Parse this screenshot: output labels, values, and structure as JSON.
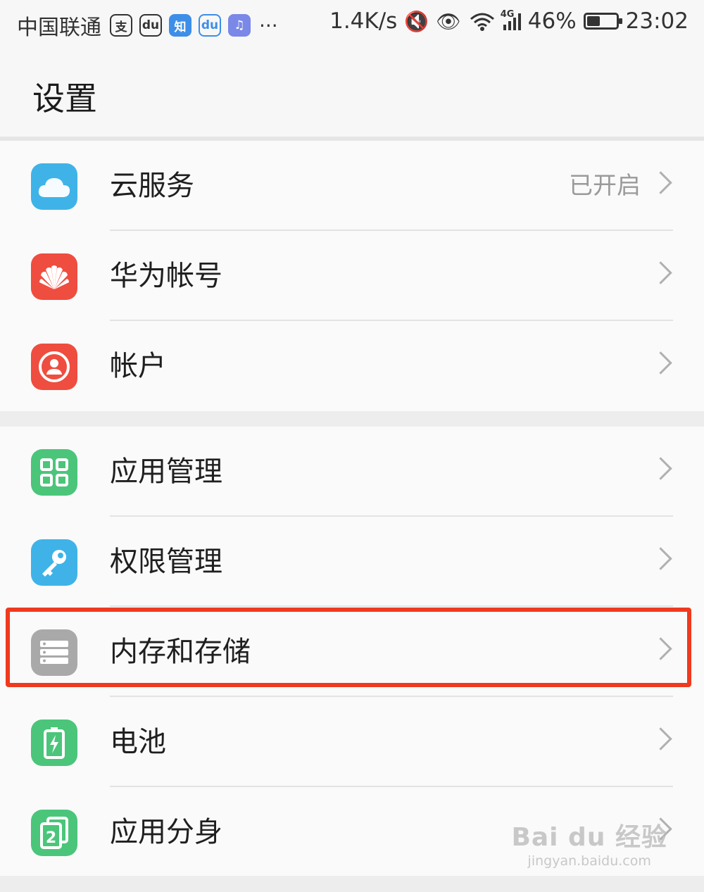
{
  "status_bar": {
    "carrier": "中国联通",
    "notif_icons": [
      {
        "name": "alipay-icon",
        "glyph": "支",
        "color": "#333333",
        "bg": "transparent"
      },
      {
        "name": "baidu-icon",
        "glyph": "du",
        "color": "#333333",
        "bg": "transparent"
      },
      {
        "name": "zhihu-icon",
        "glyph": "知",
        "color": "#ffffff",
        "bg": "#3d8ee8"
      },
      {
        "name": "baidu-app-icon",
        "glyph": "du",
        "color": "#3d8ee8",
        "bg": "transparent"
      },
      {
        "name": "music-icon",
        "glyph": "♫",
        "color": "#ffffff",
        "bg": "#7a88e8"
      }
    ],
    "more": "···",
    "net_speed": "1.4K/s",
    "network_type": "4G",
    "battery_percent": "46%",
    "battery_level": 0.46,
    "time": "23:02"
  },
  "header": {
    "title": "设置"
  },
  "groups": [
    {
      "items": [
        {
          "id": "cloud",
          "label": "云服务",
          "value": "已开启",
          "icon": "cloud-icon",
          "color": "#3fb3e8"
        },
        {
          "id": "huawei",
          "label": "华为帐号",
          "value": "",
          "icon": "huawei-logo-icon",
          "color": "#ef4d3f"
        },
        {
          "id": "account",
          "label": "帐户",
          "value": "",
          "icon": "user-icon",
          "color": "#ef4d3f"
        }
      ]
    },
    {
      "items": [
        {
          "id": "apps",
          "label": "应用管理",
          "value": "",
          "icon": "apps-grid-icon",
          "color": "#4bc57a"
        },
        {
          "id": "permissions",
          "label": "权限管理",
          "value": "",
          "icon": "key-icon",
          "color": "#3fb3e8"
        },
        {
          "id": "storage",
          "label": "内存和存储",
          "value": "",
          "icon": "storage-icon",
          "color": "#a9a9a9"
        },
        {
          "id": "battery",
          "label": "电池",
          "value": "",
          "icon": "battery-icon",
          "color": "#4bc57a"
        },
        {
          "id": "twin",
          "label": "应用分身",
          "value": "",
          "icon": "app-twin-icon",
          "color": "#4bc57a"
        }
      ]
    }
  ],
  "watermark": {
    "main": "Bai du 经验",
    "sub": "jingyan.baidu.com"
  }
}
